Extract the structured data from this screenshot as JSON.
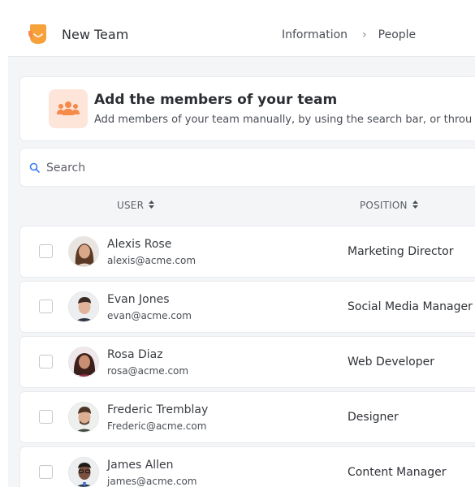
{
  "header": {
    "app_title": "New Team",
    "breadcrumb": [
      "Information",
      "People"
    ]
  },
  "intro": {
    "title": "Add the members of your team",
    "subtitle": "Add members of your team manually, by using the search bar, or throu"
  },
  "search": {
    "placeholder": "Search"
  },
  "table": {
    "columns": [
      "USER",
      "POSITION"
    ],
    "rows": [
      {
        "name": "Alexis Rose",
        "email": "alexis@acme.com",
        "position": "Marketing Director"
      },
      {
        "name": "Evan Jones",
        "email": "evan@acme.com",
        "position": "Social Media Manager"
      },
      {
        "name": "Rosa Diaz",
        "email": "rosa@acme.com",
        "position": "Web Developer"
      },
      {
        "name": "Frederic Tremblay",
        "email": "Frederic@acme.com",
        "position": "Designer"
      },
      {
        "name": "James Allen",
        "email": "james@acme.com",
        "position": "Content Manager"
      }
    ]
  },
  "colors": {
    "accent": "#f58a4b",
    "icon_bg": "#fde5d9",
    "search_icon": "#3b7bf6"
  },
  "icons": [
    "logo-icon",
    "team-icon",
    "search-icon",
    "sort-icon",
    "chevron-right-icon"
  ]
}
